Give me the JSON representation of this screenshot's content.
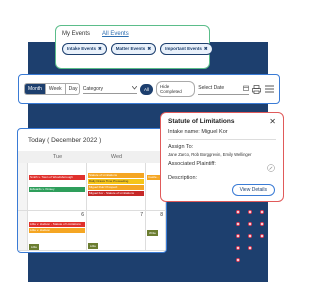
{
  "events_panel": {
    "tab_my": "My Events",
    "tab_all": "All Events",
    "chips": [
      {
        "label": "Intake Events",
        "close": "✖"
      },
      {
        "label": "Matter Events",
        "close": "✖"
      },
      {
        "label": "Important Events",
        "close": "✖"
      }
    ]
  },
  "toolbar": {
    "views": [
      "Month",
      "Week",
      "Day"
    ],
    "active_view": "Month",
    "category_value": "Category",
    "filter_all": "All",
    "filter_hide": "Hide Completed",
    "date_placeholder": "Select Date"
  },
  "calendar": {
    "heading": "Today ( December 2022 )",
    "days": [
      "",
      "Tue",
      "Wed",
      ""
    ],
    "week1": {
      "tue": [
        "Smith v. Town of Woodsborough",
        "",
        "Edwards v. Kinsey"
      ],
      "wed": [
        "Statute of Limitations",
        "Daily Draws Time Proceeding",
        "Miguel Ruiz Prospect",
        "Miguel Kor - Statute of Limitations"
      ],
      "side": [
        "Castle..."
      ]
    },
    "week2": {
      "tue_num": "6",
      "wed_num": "7",
      "side_num": "8",
      "tue": [
        "Lillie v. Hudson - Statute of Limitations",
        "Lillie v. Hudson"
      ],
      "tue_badge": "Lillie",
      "wed_badge": "Lillie",
      "side_badge": "Write"
    }
  },
  "statute": {
    "title": "Statute of Limitations",
    "close": "✕",
    "intake": "Intake name: Miguel Kor",
    "assign_label": "Assign To:",
    "assignees": "Jane Zarco, Rob Borggrevin, Emily Wellinger",
    "plaintiff_label": "Associated Plaintiff:",
    "description_label": "Description:",
    "button": "View Details"
  },
  "colors": {
    "navy": "#1d3f6e",
    "accent_blue": "#3a7bd5",
    "green_border": "#5bbd8a",
    "red_border": "#e05a5a"
  }
}
